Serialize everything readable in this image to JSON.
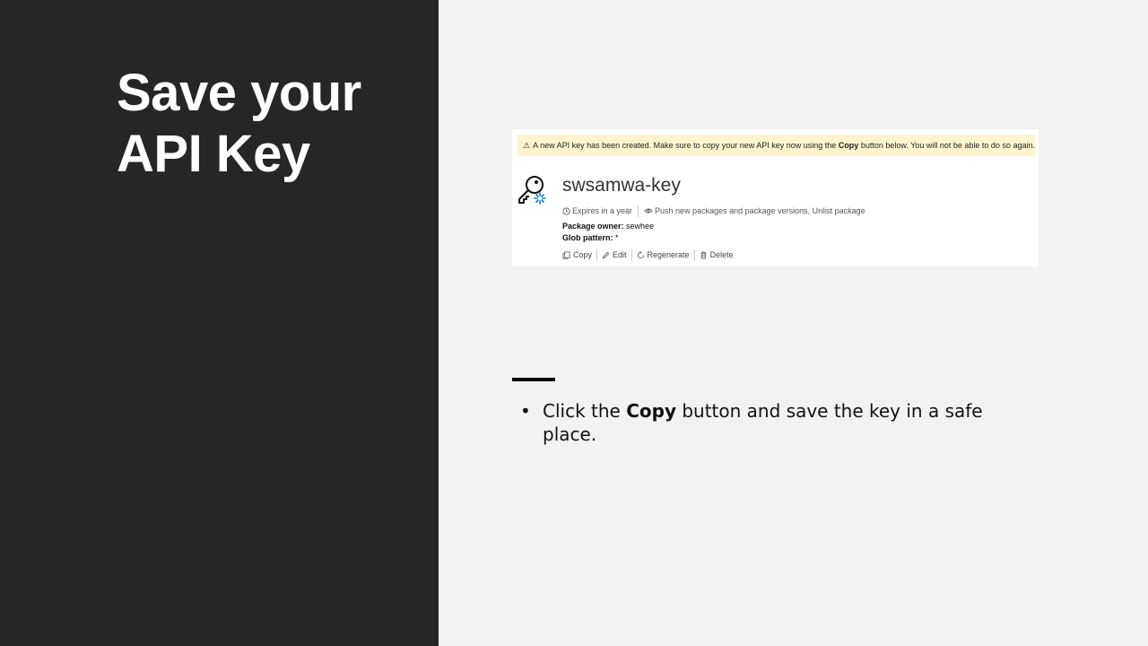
{
  "slide": {
    "title_line1": "Save your",
    "title_line2": "API Key"
  },
  "screenshot": {
    "banner": {
      "icon": "warning-icon",
      "text_before": "A new API key has been created. Make sure to copy your new API key now using the",
      "text_bold": "Copy",
      "text_after": "button below. You will not be able to do so again.",
      "background": "#fff4ce"
    },
    "key": {
      "name": "swsamwa-key",
      "expires": "Expires in a year",
      "scopes": "Push new packages and package versions, Unlist package",
      "package_owner_label": "Package owner:",
      "package_owner_value": "sewhee",
      "glob_pattern_label": "Glob pattern:",
      "glob_pattern_value": "*"
    },
    "actions": {
      "copy": "Copy",
      "edit": "Edit",
      "regenerate": "Regenerate",
      "delete": "Delete"
    }
  },
  "bullets": [
    {
      "before": "Click the",
      "bold": "Copy",
      "after": "button and save the key in a safe place."
    }
  ],
  "colors": {
    "left_panel": "#262626",
    "right_panel": "#f2f2f2",
    "accent_blue": "#0078d4"
  }
}
